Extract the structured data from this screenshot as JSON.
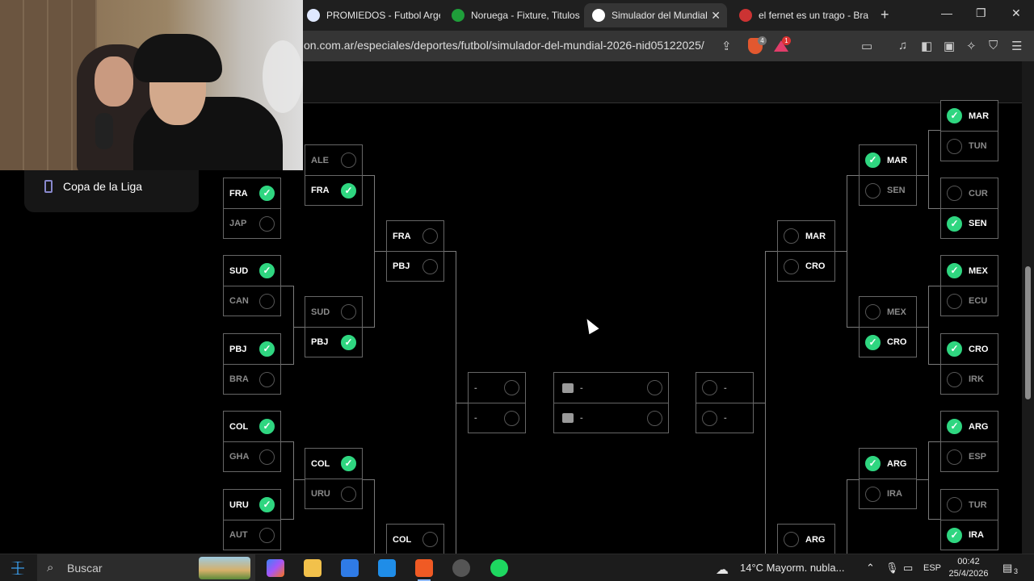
{
  "browser": {
    "tabs": [
      {
        "title": "PROMIEDOS - Futbol Argentino",
        "active": false
      },
      {
        "title": "Noruega - Fixture, Titulos y ...",
        "active": false
      },
      {
        "title": "Simulador del Mundial",
        "active": true
      },
      {
        "title": "el fernet es un trago - Brave",
        "active": false
      }
    ],
    "url": "on.com.ar/especiales/deportes/futbol/simulador-del-mundial-2026-nid05122025/",
    "shield_count": "4",
    "alert_count": "1"
  },
  "overlay": {
    "sidebar_label": "Copa de la Liga"
  },
  "bracket": {
    "left_r32": [
      {
        "t1": "FRA",
        "t2": "JAP",
        "winner": 1
      },
      {
        "t1": "SUD",
        "t2": "CAN",
        "winner": 1
      },
      {
        "t1": "PBJ",
        "t2": "BRA",
        "winner": 1
      },
      {
        "t1": "COL",
        "t2": "GHA",
        "winner": 1
      },
      {
        "t1": "URU",
        "t2": "AUT",
        "winner": 1
      }
    ],
    "left_r16": [
      {
        "t1": "ALE",
        "t2": "FRA",
        "winner": 2
      },
      {
        "t1": "SUD",
        "t2": "PBJ",
        "winner": 2
      },
      {
        "t1": "COL",
        "t2": "URU",
        "winner": 1
      }
    ],
    "left_qf": [
      {
        "t1": "FRA",
        "t2": "PBJ",
        "winner": 0
      },
      {
        "t1": "COL",
        "winner": 0
      }
    ],
    "semi_left": {
      "t1": "-",
      "t2": "-"
    },
    "final": {
      "t1": "-",
      "t2": "-"
    },
    "semi_right": {
      "t1": "-",
      "t2": "-"
    },
    "right_qf": [
      {
        "t1": "MAR",
        "t2": "CRO",
        "winner": 0
      },
      {
        "t1": "ARG",
        "winner": 0
      }
    ],
    "right_r16": [
      {
        "t1": "MAR",
        "t2": "SEN",
        "winner": 1
      },
      {
        "t1": "MEX",
        "t2": "CRO",
        "winner": 2
      },
      {
        "t1": "ARG",
        "t2": "IRA",
        "winner": 1
      }
    ],
    "right_r32": [
      {
        "t1": "MAR",
        "t2": "TUN",
        "winner": 1
      },
      {
        "t1": "CUR",
        "t2": "SEN",
        "winner": 2
      },
      {
        "t1": "MEX",
        "t2": "ECU",
        "winner": 1
      },
      {
        "t1": "CRO",
        "t2": "IRK",
        "winner": 1
      },
      {
        "t1": "ARG",
        "t2": "ESP",
        "winner": 1
      },
      {
        "t1": "TUR",
        "t2": "IRA",
        "winner": 2
      }
    ]
  },
  "taskbar": {
    "search_placeholder": "Buscar",
    "weather": "14°C  Mayorm. nubla...",
    "language": "ESP",
    "time": "00:42",
    "date": "25/4/2026",
    "notifications": "3"
  }
}
